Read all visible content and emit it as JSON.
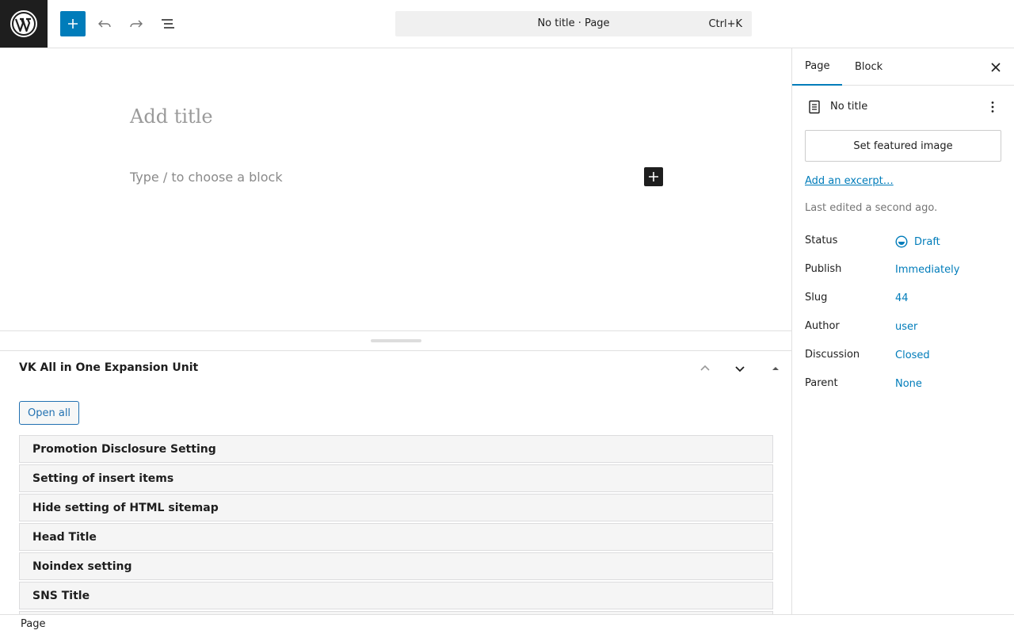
{
  "topbar": {
    "command_bar_title": "No title · Page",
    "command_bar_shortcut": "Ctrl+K"
  },
  "icons": {
    "logo": "wordpress-logo-icon",
    "add": "plus-icon",
    "undo": "undo-icon",
    "redo": "redo-icon",
    "list_view": "list-view-icon",
    "close": "close-icon",
    "document": "page-document-icon",
    "more": "more-vertical-icon",
    "status": "draft-status-icon",
    "chevron_up": "chevron-up-icon",
    "chevron_down": "chevron-down-icon",
    "toggle": "triangle-up-icon"
  },
  "colors": {
    "accent": "#007cba",
    "dark": "#1e1e1e",
    "link": "#2271b1"
  },
  "editor": {
    "title_placeholder": "Add title",
    "block_placeholder": "Type / to choose a block"
  },
  "metabox": {
    "title": "VK All in One Expansion Unit",
    "open_all_label": "Open all",
    "items": [
      "Promotion Disclosure Setting",
      "Setting of insert items",
      "Hide setting of HTML sitemap",
      "Head Title",
      "Noindex setting",
      "SNS Title"
    ]
  },
  "sidebar": {
    "tabs": [
      "Page",
      "Block"
    ],
    "active_tab": "Page",
    "doc_title": "No title",
    "featured_image_label": "Set featured image",
    "excerpt_link": "Add an excerpt…",
    "last_edited": "Last edited a second ago.",
    "properties": [
      {
        "label": "Status",
        "value": "Draft"
      },
      {
        "label": "Publish",
        "value": "Immediately"
      },
      {
        "label": "Slug",
        "value": "44"
      },
      {
        "label": "Author",
        "value": "user"
      },
      {
        "label": "Discussion",
        "value": "Closed"
      },
      {
        "label": "Parent",
        "value": "None"
      }
    ]
  },
  "footer": {
    "breadcrumb": "Page"
  }
}
